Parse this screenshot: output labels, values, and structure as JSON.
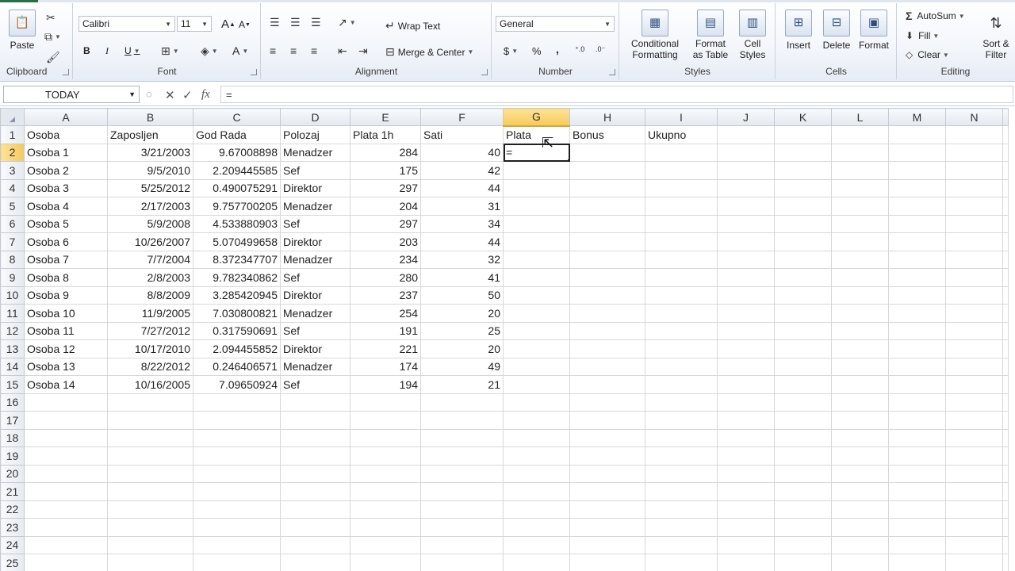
{
  "ribbon": {
    "clipboard": {
      "label": "Clipboard",
      "paste": "Paste"
    },
    "font": {
      "label": "Font",
      "font_name": "Calibri",
      "font_size": "11",
      "bold": "B",
      "italic": "I",
      "underline": "U",
      "grow": "A",
      "shrink": "A",
      "font_color": "A"
    },
    "alignment": {
      "label": "Alignment",
      "wrap_text": "Wrap Text",
      "merge_center": "Merge & Center"
    },
    "number": {
      "label": "Number",
      "format": "General",
      "currency": "$",
      "percent": "%",
      "comma": ","
    },
    "styles": {
      "label": "Styles",
      "conditional_formatting": [
        "Conditional",
        "Formatting"
      ],
      "format_as_table": [
        "Format",
        "as Table"
      ],
      "cell_styles": [
        "Cell",
        "Styles"
      ]
    },
    "cells": {
      "label": "Cells",
      "insert": "Insert",
      "delete": "Delete",
      "format": "Format"
    },
    "editing": {
      "label": "Editing",
      "autosum": "AutoSum",
      "fill": "Fill",
      "clear": "Clear",
      "sort_filter": [
        "Sort &",
        "Filter"
      ]
    }
  },
  "formula_bar": {
    "name_box": "TODAY",
    "formula": "="
  },
  "columns": [
    "A",
    "B",
    "C",
    "D",
    "E",
    "F",
    "G",
    "H",
    "I",
    "J",
    "K",
    "L",
    "M",
    "N"
  ],
  "active_column": "G",
  "active_row": 2,
  "headers": [
    "Osoba",
    "Zaposljen",
    "God Rada",
    "Polozaj",
    "Plata 1h",
    "Sati",
    "Plata",
    "Bonus",
    "Ukupno"
  ],
  "rows": [
    [
      "Osoba 1",
      "3/21/2003",
      "9.67008898",
      "Menadzer",
      "284",
      "40",
      "="
    ],
    [
      "Osoba 2",
      "9/5/2010",
      "2.209445585",
      "Sef",
      "175",
      "42",
      ""
    ],
    [
      "Osoba 3",
      "5/25/2012",
      "0.490075291",
      "Direktor",
      "297",
      "44",
      ""
    ],
    [
      "Osoba 4",
      "2/17/2003",
      "9.757700205",
      "Menadzer",
      "204",
      "31",
      ""
    ],
    [
      "Osoba 5",
      "5/9/2008",
      "4.533880903",
      "Sef",
      "297",
      "34",
      ""
    ],
    [
      "Osoba 6",
      "10/26/2007",
      "5.070499658",
      "Direktor",
      "203",
      "44",
      ""
    ],
    [
      "Osoba 7",
      "7/7/2004",
      "8.372347707",
      "Menadzer",
      "234",
      "32",
      ""
    ],
    [
      "Osoba 8",
      "2/8/2003",
      "9.782340862",
      "Sef",
      "280",
      "41",
      ""
    ],
    [
      "Osoba 9",
      "8/8/2009",
      "3.285420945",
      "Direktor",
      "237",
      "50",
      ""
    ],
    [
      "Osoba 10",
      "11/9/2005",
      "7.030800821",
      "Menadzer",
      "254",
      "20",
      ""
    ],
    [
      "Osoba 11",
      "7/27/2012",
      "0.317590691",
      "Sef",
      "191",
      "25",
      ""
    ],
    [
      "Osoba 12",
      "10/17/2010",
      "2.094455852",
      "Direktor",
      "221",
      "20",
      ""
    ],
    [
      "Osoba 13",
      "8/22/2012",
      "0.246406571",
      "Menadzer",
      "174",
      "49",
      ""
    ],
    [
      "Osoba 14",
      "10/16/2005",
      "7.09650924",
      "Sef",
      "194",
      "21",
      ""
    ]
  ],
  "empty_row_numbers": [
    16,
    17,
    18,
    19,
    20,
    21,
    22,
    23,
    24,
    25
  ],
  "icons": [
    "paste-icon",
    "cut-icon",
    "copy-icon",
    "format-painter-icon",
    "sum-icon",
    "cursor-icon"
  ]
}
